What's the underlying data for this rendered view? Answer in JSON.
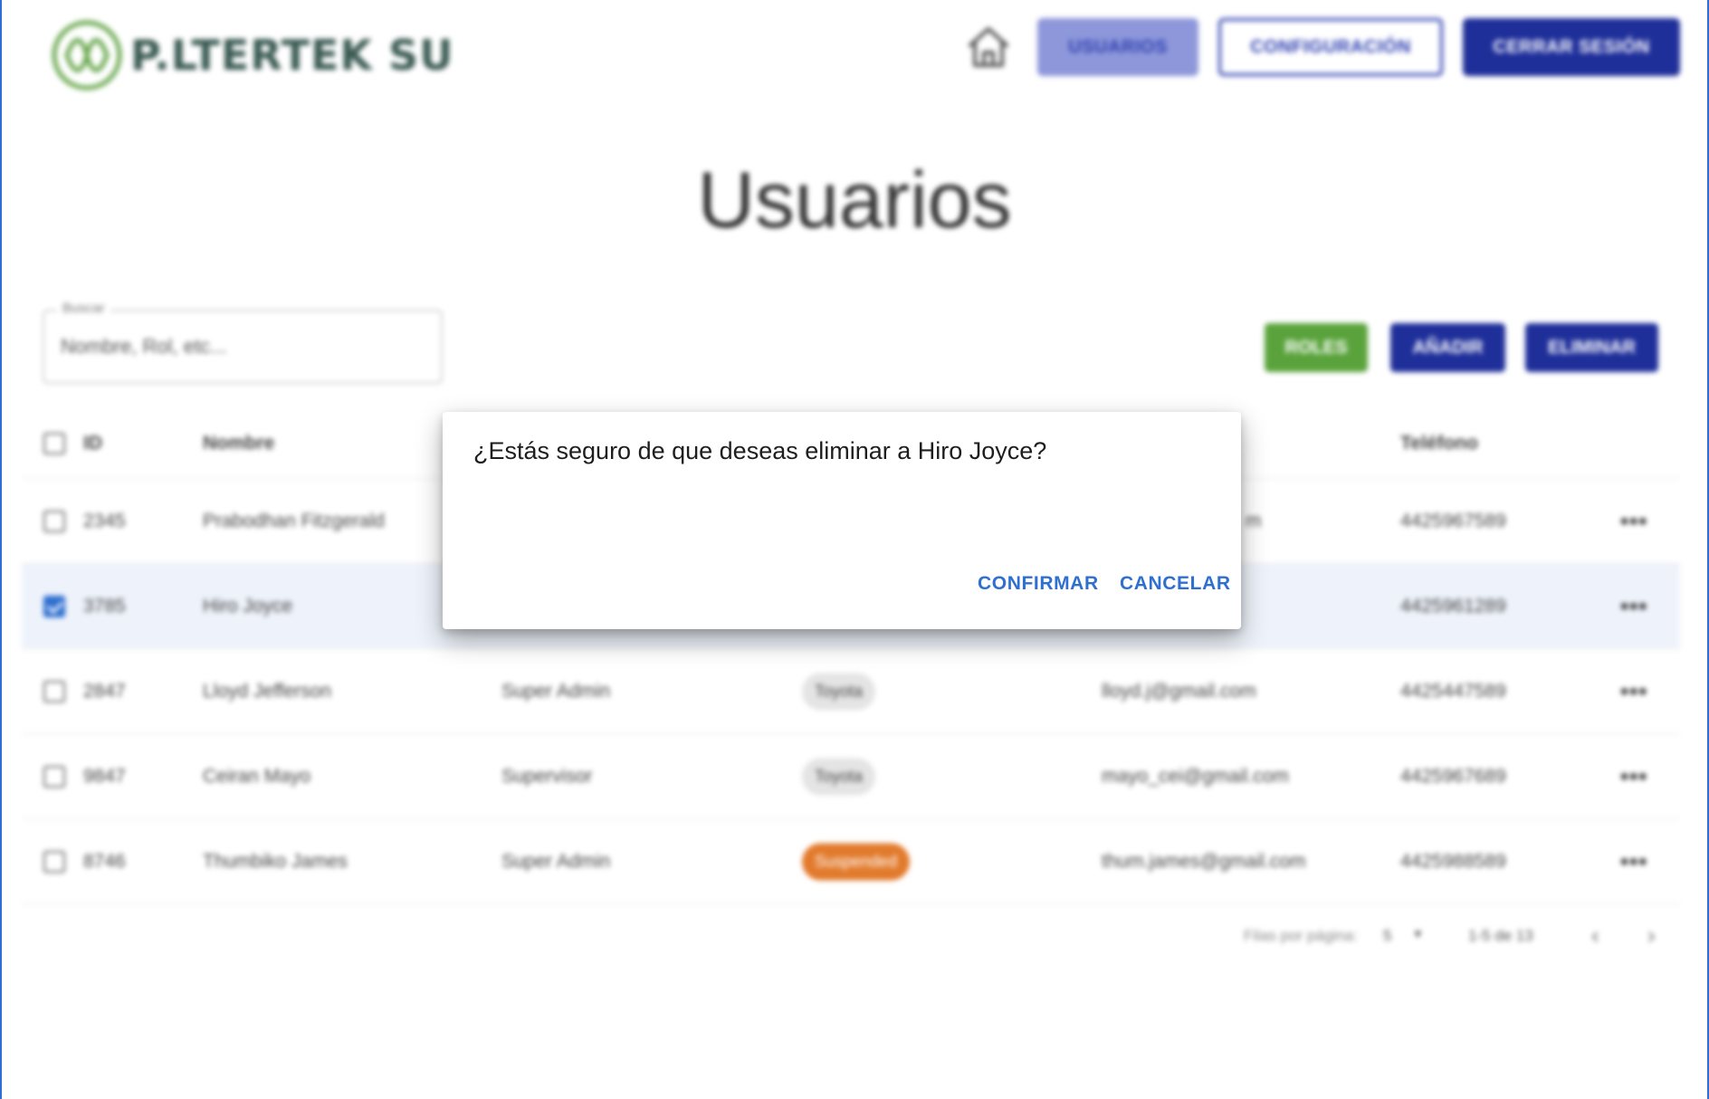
{
  "header": {
    "logo_text": "P.LTERTEK SU",
    "nav": {
      "usuarios": "USUARIOS",
      "configuracion": "CONFIGURACIÓN",
      "cerrar_sesion": "CERRAR SESIÓN"
    }
  },
  "page": {
    "title": "Usuarios"
  },
  "search": {
    "legend": "Buscar",
    "placeholder": "Nombre, Rol, etc..."
  },
  "actions": {
    "roles": "ROLES",
    "add": "AÑADIR",
    "delete": "ELIMINAR"
  },
  "table": {
    "headers": {
      "id": "ID",
      "name": "Nombre",
      "phone": "Teléfono"
    },
    "rows": [
      {
        "id": "2345",
        "name": "Prabodhan Fitzgerald",
        "role": "",
        "status": "",
        "email": "m",
        "phone": "4425967589",
        "checked": false
      },
      {
        "id": "3785",
        "name": "Hiro Joyce",
        "role": "",
        "status": "",
        "email": "",
        "phone": "4425961289",
        "checked": true
      },
      {
        "id": "2847",
        "name": "Lloyd Jefferson",
        "role": "Super Admin",
        "status": "Toyota",
        "email": "lloyd.j@gmail.com",
        "phone": "4425447589",
        "checked": false
      },
      {
        "id": "9847",
        "name": "Ceiran Mayo",
        "role": "Supervisor",
        "status": "Toyota",
        "email": "mayo_cei@gmail.com",
        "phone": "4425967689",
        "checked": false
      },
      {
        "id": "8746",
        "name": "Thumbiko James",
        "role": "Super Admin",
        "status": "Suspended",
        "email": "thum.james@gmail.com",
        "phone": "4425988589",
        "checked": false
      }
    ]
  },
  "pagination": {
    "rows_label": "Filas por página:",
    "rows_value": "5",
    "range": "1-5 de 13"
  },
  "dialog": {
    "message": "¿Estás seguro de que deseas eliminar a Hiro Joyce?",
    "confirm": "CONFIRMAR",
    "cancel": "CANCELAR"
  },
  "colors": {
    "primary": "#1f2f9a",
    "accent_blue": "#2f6fd0",
    "green": "#5aa33c",
    "orange": "#e27a2c"
  },
  "icons": {
    "home": "home-icon",
    "more": "more-horizontal-icon",
    "prev": "chevron-left-icon",
    "next": "chevron-right-icon"
  }
}
